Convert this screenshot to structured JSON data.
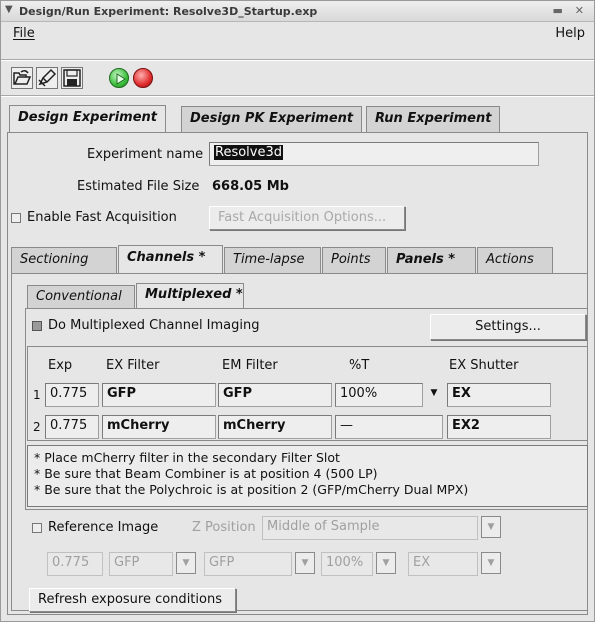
{
  "window": {
    "title": "Design/Run Experiment: Resolve3D_Startup.exp"
  },
  "menu": {
    "file": "File",
    "help": "Help"
  },
  "main_tabs": [
    {
      "label": "Design Experiment",
      "active": true
    },
    {
      "label": "Design PK Experiment",
      "active": false
    },
    {
      "label": "Run Experiment",
      "active": false
    }
  ],
  "experiment": {
    "name_label": "Experiment name",
    "name_value": "Resolve3d",
    "size_label": "Estimated File Size",
    "size_value": "668.05 Mb",
    "fast_acq_label": "Enable Fast Acquisition",
    "fast_acq_button": "Fast Acquisition Options..."
  },
  "sub_tabs": [
    {
      "label": "Sectioning",
      "active": false
    },
    {
      "label": "Channels *",
      "active": true
    },
    {
      "label": "Time-lapse",
      "active": false
    },
    {
      "label": "Points",
      "active": false
    },
    {
      "label": "Panels *",
      "active": false
    },
    {
      "label": "Actions",
      "active": false
    }
  ],
  "channel_tabs": [
    {
      "label": "Conventional",
      "active": false
    },
    {
      "label": "Multiplexed *",
      "active": true
    }
  ],
  "multiplexed": {
    "do_label": "Do Multiplexed Channel Imaging",
    "settings_button": "Settings..."
  },
  "table": {
    "headers": [
      "Exp",
      "EX Filter",
      "EM Filter",
      "%T",
      "EX Shutter"
    ],
    "rows": [
      {
        "index": "1",
        "exp": "0.775",
        "ex": "GFP",
        "em": "GFP",
        "t": "100%",
        "shutter": "EX"
      },
      {
        "index": "2",
        "exp": "0.775",
        "ex": "mCherry",
        "em": "mCherry",
        "t": "—",
        "shutter": "EX2"
      }
    ]
  },
  "notes": [
    "* Place mCherry filter in the secondary Filter Slot",
    "* Be sure that Beam Combiner is at position 4 (500 LP)",
    "* Be sure that the Polychroic is at position 2 (GFP/mCherry Dual MPX)"
  ],
  "reference": {
    "label": "Reference Image",
    "z_label": "Z Position",
    "z_value": "Middle of Sample",
    "exp": "0.775",
    "ex": "GFP",
    "em": "GFP",
    "t": "100%",
    "shutter": "EX"
  },
  "refresh_button": "Refresh exposure conditions",
  "colors": {
    "background": "#e6e6e6",
    "play_green": "#3bbf3b",
    "record_red": "#e02a2a",
    "name_field_bg": "#111111",
    "name_field_fg": "#ffffff"
  },
  "icons": [
    "open-folder-icon",
    "edit-icon",
    "save-icon",
    "play-icon",
    "record-icon",
    "dropdown-arrow-icon"
  ]
}
